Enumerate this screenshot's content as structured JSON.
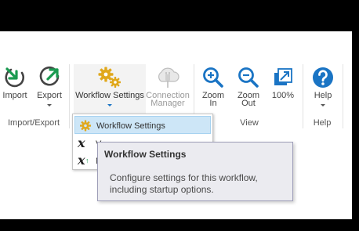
{
  "ribbon": {
    "buttons": {
      "import": "Import",
      "export": "Export",
      "workflow_settings": "Workflow Settings",
      "connection_manager_line1": "Connection",
      "connection_manager_line2": "Manager",
      "zoom_in_line1": "Zoom",
      "zoom_in_line2": "In",
      "zoom_out_line1": "Zoom",
      "zoom_out_line2": "Out",
      "zoom_100": "100%",
      "help": "Help"
    },
    "groups": {
      "import_export": "Import/Export",
      "view": "View",
      "help": "Help"
    }
  },
  "dropdown": {
    "items": [
      {
        "label": "Workflow Settings",
        "icon": "gear-icon",
        "selected": true
      },
      {
        "label": "V",
        "icon": "variable-x-icon"
      },
      {
        "label": "M",
        "icon": "variable-x-up-icon"
      }
    ]
  },
  "tooltip": {
    "title": "Workflow Settings",
    "description": "Configure settings for this workflow, including startup options."
  },
  "colors": {
    "icon_green": "#1a9a50",
    "icon_blue": "#1a74c4",
    "gear_gold": "#e0a81c",
    "selection_bg": "#cde6f7",
    "tooltip_bg": "#ebebf0"
  }
}
